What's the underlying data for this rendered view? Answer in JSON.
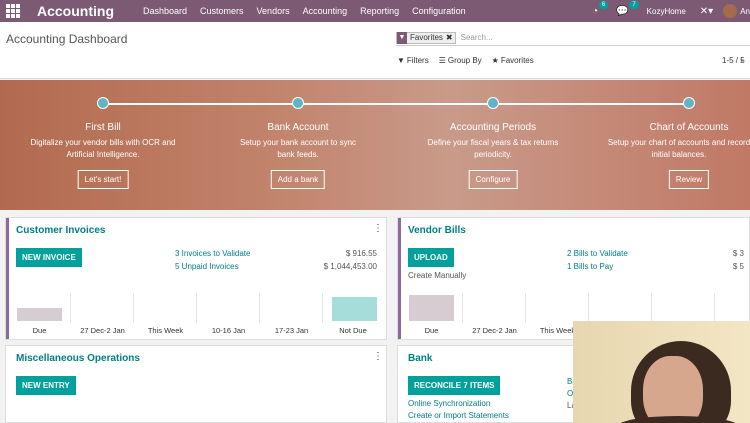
{
  "navbar": {
    "brand": "Accounting",
    "menu": [
      "Dashboard",
      "Customers",
      "Vendors",
      "Accounting",
      "Reporting",
      "Configuration"
    ],
    "activity_count": "6",
    "messages_count": "7",
    "company": "KozyHome",
    "user": "An"
  },
  "control_panel": {
    "title": "Accounting Dashboard",
    "facet_label": "Favorites",
    "search_placeholder": "Search...",
    "filters_label": "Filters",
    "group_by_label": "Group By",
    "favorites_label": "Favorites",
    "pager": "1-5 / 5"
  },
  "banner": {
    "steps": [
      {
        "title": "First Bill",
        "desc": "Digitalize your vendor bills with OCR and Artificial Intelligence.",
        "button": "Let's start!"
      },
      {
        "title": "Bank Account",
        "desc": "Setup your bank account to sync bank feeds.",
        "button": "Add a bank"
      },
      {
        "title": "Accounting Periods",
        "desc": "Define your fiscal years & tax returns periodicity.",
        "button": "Configure"
      },
      {
        "title": "Chart of Accounts",
        "desc": "Setup your chart of accounts and record initial balances.",
        "button": "Review"
      }
    ]
  },
  "customer_invoices": {
    "title": "Customer Invoices",
    "button": "NEW INVOICE",
    "link1": "3 Invoices to Validate",
    "amount1": "$ 916.55",
    "link2": "5 Unpaid Invoices",
    "amount2": "$ 1,044,453.00",
    "graph_labels": [
      "Due",
      "27 Dec-2 Jan",
      "This Week",
      "10-16 Jan",
      "17-23 Jan",
      "Not Due"
    ]
  },
  "vendor_bills": {
    "title": "Vendor Bills",
    "button": "UPLOAD",
    "create_manually": "Create Manually",
    "link1": "2 Bills to Validate",
    "link2": "1 Bills to Pay",
    "amount1": "$ 3",
    "amount2": "$ 5",
    "graph_labels": [
      "Due",
      "27 Dec-2 Jan",
      "This Week"
    ]
  },
  "misc_operations": {
    "title": "Miscellaneous Operations",
    "button": "NEW ENTRY"
  },
  "bank": {
    "title": "Bank",
    "button": "RECONCILE 7 ITEMS",
    "link1": "Online Synchronization",
    "link2": "Create or Import Statements",
    "side1": "Ba",
    "side2": "O",
    "side3": "La"
  },
  "colors": {
    "navbar": "#7c5a74",
    "primary": "#00a09d",
    "title": "#017e84"
  }
}
